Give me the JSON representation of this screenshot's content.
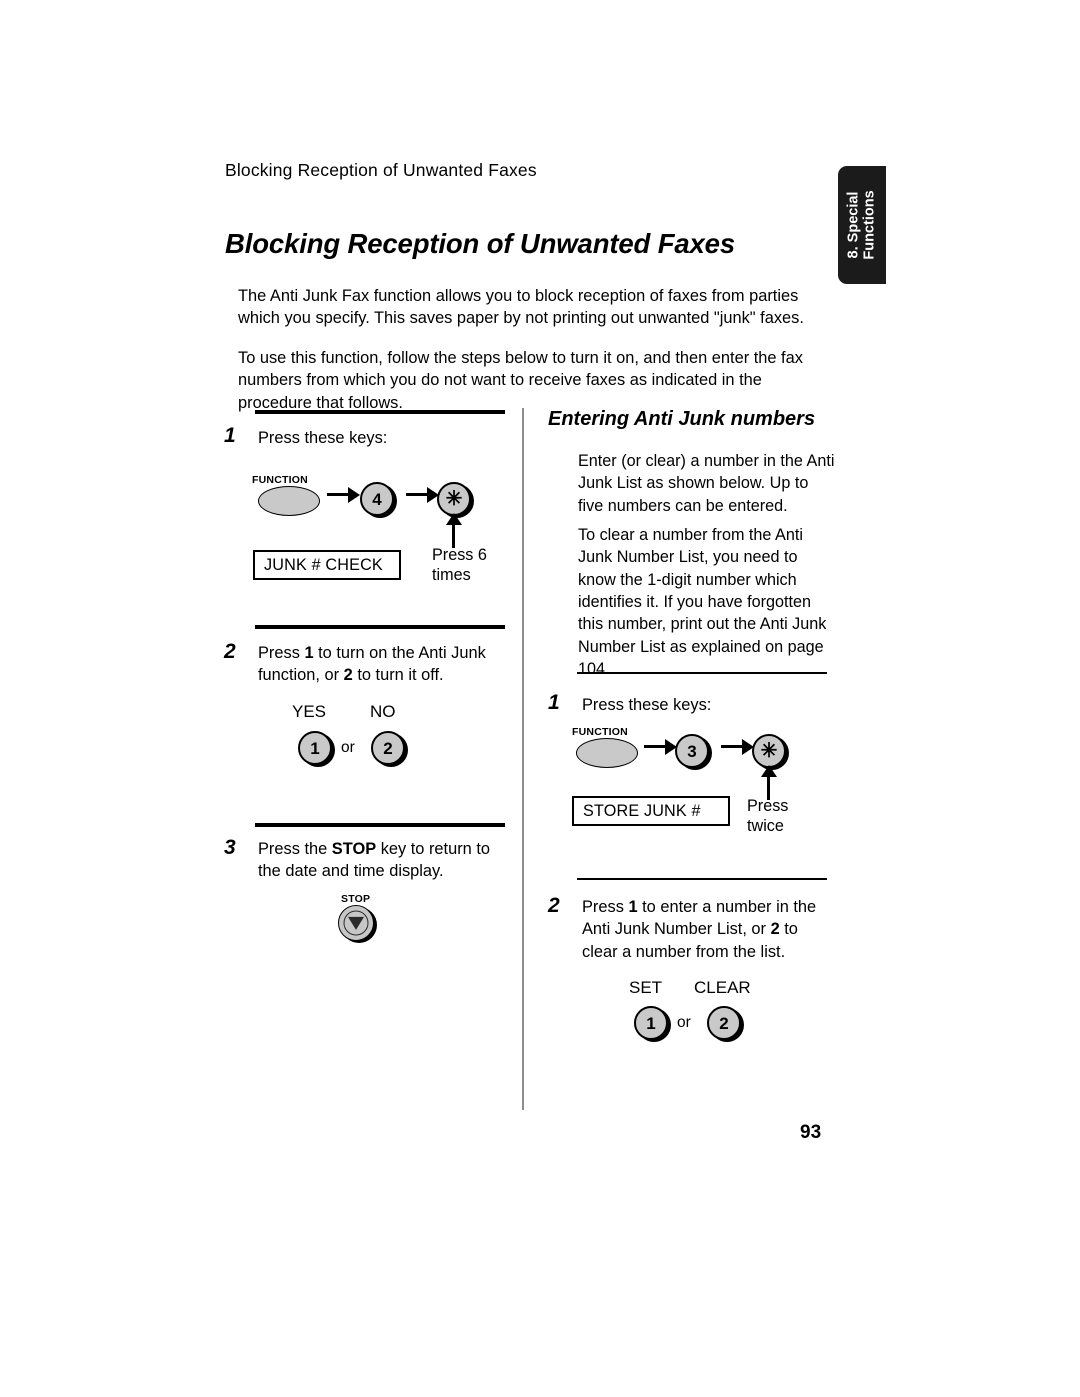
{
  "page": {
    "running_header": "Blocking Reception of Unwanted Faxes",
    "title": "Blocking Reception of Unwanted Faxes",
    "folio": "93",
    "side_tab": {
      "line1": "8. Special",
      "line2": "Functions"
    },
    "intro": [
      "The Anti Junk Fax function allows you to block reception of faxes from parties which you specify. This saves paper by not printing out unwanted \"junk\" faxes.",
      "To use this function, follow the steps below to turn it on, and then enter the fax numbers from which you do not want to receive faxes as indicated in the procedure that follows."
    ]
  },
  "left_column": {
    "step1": {
      "number": "1",
      "text": "Press these keys:",
      "function_key_label": "FUNCTION",
      "key_digit": "4",
      "key_star": "✳",
      "display_text": "JUNK # CHECK",
      "annotation_line1": "Press 6",
      "annotation_line2": "times"
    },
    "step2": {
      "number": "2",
      "text_part1": "Press ",
      "text_bold1": "1",
      "text_part2": " to turn on the Anti Junk function, or ",
      "text_bold2": "2",
      "text_part3": " to turn it off.",
      "label_yes": "YES",
      "label_no": "NO",
      "key_yes": "1",
      "key_no": "2",
      "or": "or"
    },
    "step3": {
      "number": "3",
      "text_part1": "Press the ",
      "text_bold1": "STOP",
      "text_part2": " key to return to the date and time display.",
      "stop_key_label": "STOP"
    }
  },
  "right_column": {
    "heading": "Entering Anti Junk numbers",
    "paragraphs": [
      "Enter (or clear) a number in the Anti Junk List as shown below. Up to five numbers can be entered.",
      "To clear a number from the Anti Junk Number List, you need to know the 1-digit number which identifies it. If you have forgotten this number, print out the Anti Junk Number List as explained on page 104."
    ],
    "step1": {
      "number": "1",
      "text": "Press these keys:",
      "function_key_label": "FUNCTION",
      "key_digit": "3",
      "key_star": "✳",
      "display_text": "STORE JUNK #",
      "annotation_line1": "Press",
      "annotation_line2": "twice"
    },
    "step2": {
      "number": "2",
      "text_part1": "Press ",
      "text_bold1": "1",
      "text_part2": " to enter a number in the Anti Junk Number List, or ",
      "text_bold2": "2",
      "text_part3": " to clear a number from the list.",
      "label_set": "SET",
      "label_clear": "CLEAR",
      "key_set": "1",
      "key_clear": "2",
      "or": "or"
    }
  }
}
